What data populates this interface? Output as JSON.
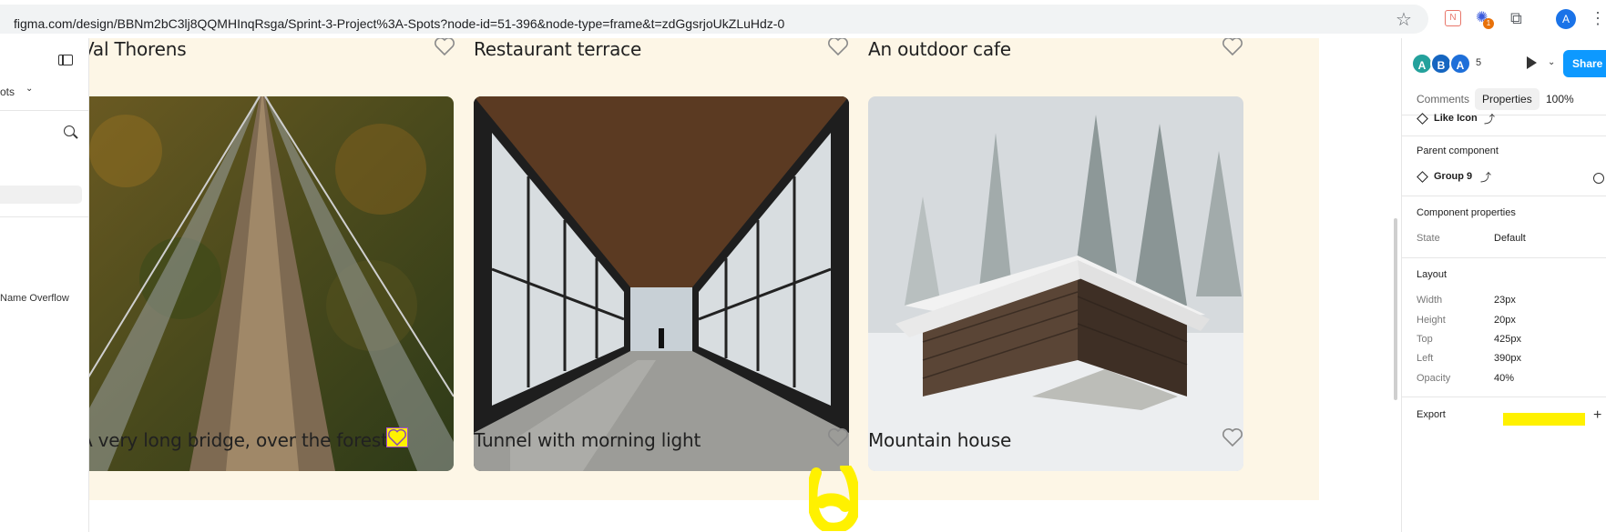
{
  "browser": {
    "url": "figma.com/design/BBNm2bC3lj8QQMHInqRsga/Sprint-3-Project%3A-Spots?node-id=51-396&node-type=frame&t=zdGgsrjoUkZLuHdz-0",
    "profile_initial": "A",
    "ext_badge": "1",
    "ext_red_label": "N"
  },
  "left_panel": {
    "pages_label": "ots",
    "layer_label": "Name Overflow"
  },
  "cards": [
    {
      "title": "Val Thorens"
    },
    {
      "title": "Restaurant terrace"
    },
    {
      "title": "An outdoor cafe"
    },
    {
      "title": "A very long bridge, over the forest..."
    },
    {
      "title": "Tunnel with morning light"
    },
    {
      "title": "Mountain house"
    }
  ],
  "right_panel": {
    "avatars": [
      {
        "initial": "A",
        "color": "#24a19c"
      },
      {
        "initial": "B",
        "color": "#1565c0"
      },
      {
        "initial": "A",
        "color": "#1e6fd9"
      }
    ],
    "collaborator_count": "5",
    "share_label": "Share",
    "tabs": {
      "comments": "Comments",
      "properties": "Properties",
      "zoom": "100%"
    },
    "component_name": "Like Icon",
    "parent_section": "Parent component",
    "parent_name": "Group 9",
    "component_props": "Component properties",
    "state_label": "State",
    "state_value": "Default",
    "layout_section": "Layout",
    "layout": [
      {
        "label": "Width",
        "value": "23px"
      },
      {
        "label": "Height",
        "value": "20px"
      },
      {
        "label": "Top",
        "value": "425px"
      },
      {
        "label": "Left",
        "value": "390px"
      },
      {
        "label": "Opacity",
        "value": "40%"
      }
    ],
    "export_label": "Export"
  }
}
